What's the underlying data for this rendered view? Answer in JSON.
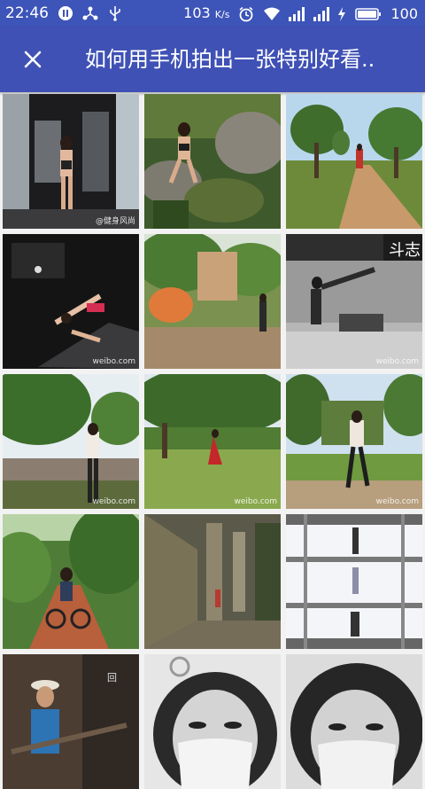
{
  "status_bar": {
    "time": "22:46",
    "network_speed": "103",
    "network_speed_unit": "K/s",
    "battery": "100",
    "icons_left": [
      "pause-circle-icon",
      "share-nodes-icon",
      "usb-icon"
    ],
    "icons_right": [
      "alarm-icon",
      "wifi-icon",
      "signal-icon",
      "signal-icon",
      "charging-icon",
      "battery-icon"
    ]
  },
  "app_bar": {
    "title": "如何用手机拍出一张特别好看..",
    "close_icon": "close-icon",
    "color": "#3f51b5"
  },
  "gallery": {
    "columns": 3,
    "photos": [
      {
        "name": "photo-gym-window",
        "watermark": "@健身风尚"
      },
      {
        "name": "photo-rocks-forest"
      },
      {
        "name": "photo-dirt-road-trees"
      },
      {
        "name": "photo-gym-dark-stretch",
        "watermark": "weibo.com"
      },
      {
        "name": "photo-park-street"
      },
      {
        "name": "photo-gym-bw-kick",
        "watermark": "weibo.com"
      },
      {
        "name": "photo-fence-greenery",
        "watermark": "weibo.com"
      },
      {
        "name": "photo-red-dress-lawn",
        "watermark": "weibo.com"
      },
      {
        "name": "photo-walking-park",
        "watermark": "weibo.com"
      },
      {
        "name": "photo-bike-trail"
      },
      {
        "name": "photo-stone-corridor"
      },
      {
        "name": "photo-window-silhouette"
      },
      {
        "name": "photo-man-hat"
      },
      {
        "name": "photo-bw-face-mask-1"
      },
      {
        "name": "photo-bw-face-mask-2"
      }
    ]
  }
}
